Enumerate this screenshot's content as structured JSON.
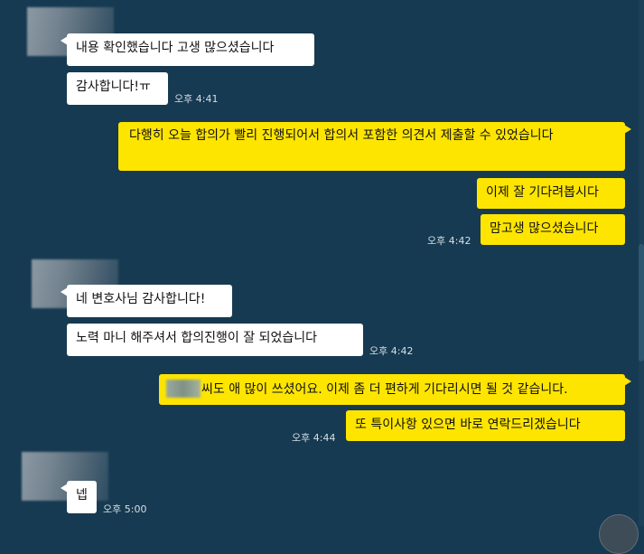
{
  "messages": {
    "m1": "내용 확인했습니다 고생 많으셨습니다",
    "m2": "감사합니다!ㅠ",
    "t1": "오후 4:41",
    "m3": "다행히 오늘 합의가 빨리 진행되어서 합의서 포함한 의견서 제출할 수 있었습니다",
    "m4": "이제 잘 기다려봅시다",
    "m5": "맘고생 많으셨습니다",
    "t2": "오후 4:42",
    "m6": "네 변호사님 감사합니다!",
    "m7": "노력 마니 해주셔서 합의진행이 잘 되었습니다",
    "t3": "오후 4:42",
    "m8": "씨도 애 많이 쓰셨어요. 이제 좀 더 편하게 기다리시면 될 것 같습니다.",
    "m9": "또 특이사항 있으면 바로 연락드리겠습니다",
    "t4": "오후 4:44",
    "m10": "넵",
    "t5": "오후 5:00"
  },
  "colors": {
    "background": "#163a51",
    "incoming_bubble": "#ffffff",
    "outgoing_bubble": "#fee500"
  },
  "icons": {
    "scroll_down": "scroll-down-button"
  }
}
